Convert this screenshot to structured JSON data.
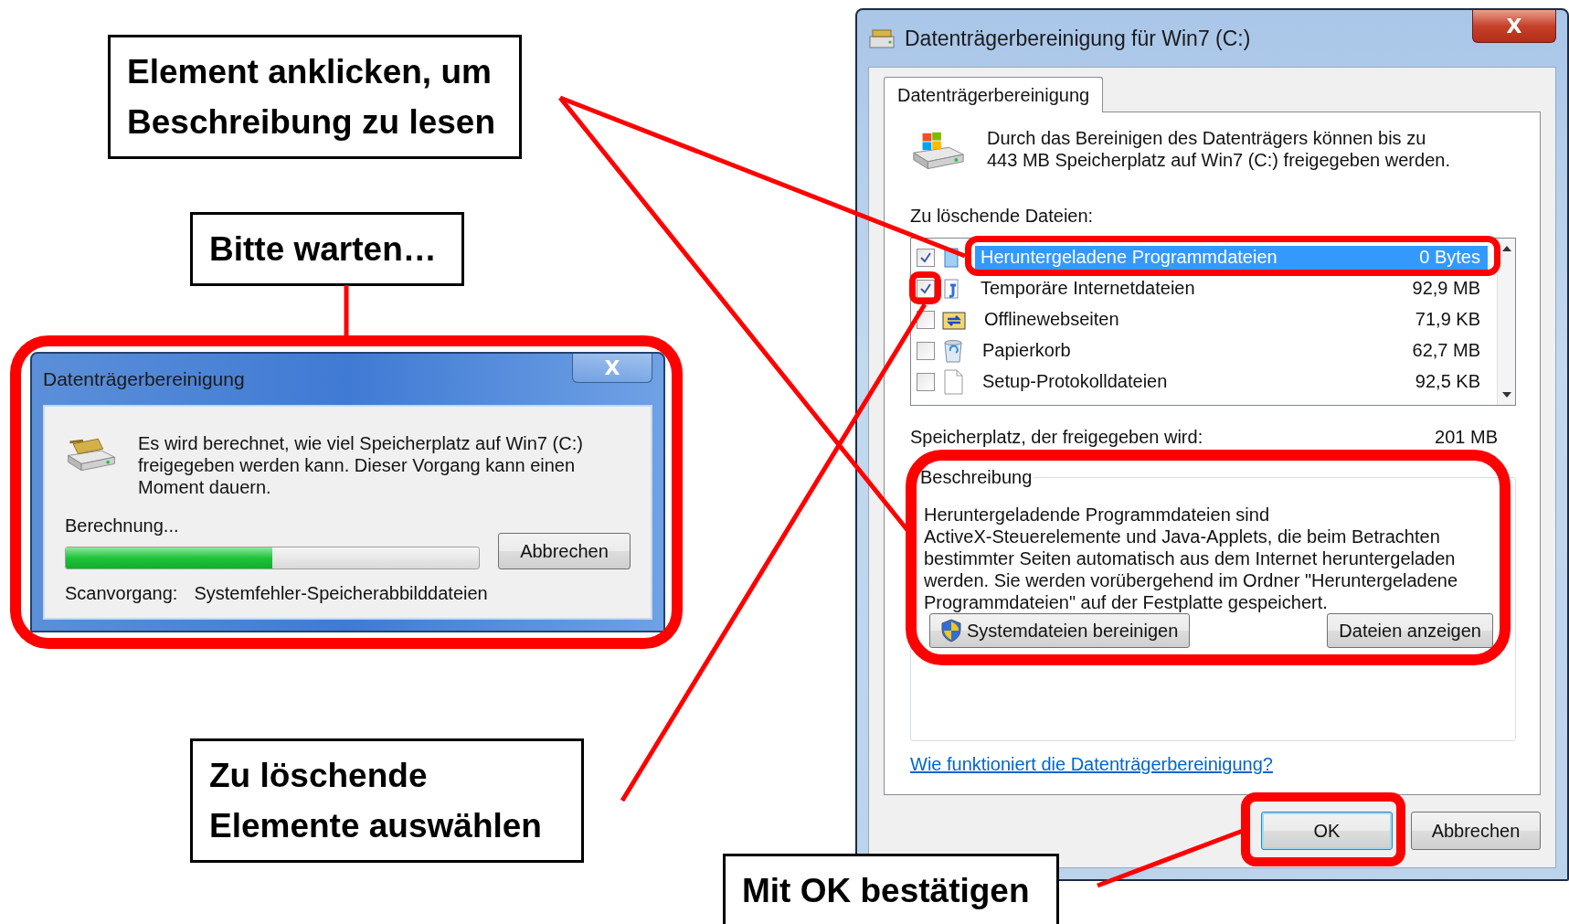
{
  "callouts": [
    {
      "lines": [
        "Element anklicken, um",
        "Beschreibung zu lesen"
      ]
    },
    {
      "lines": [
        "Bitte warten…"
      ]
    },
    {
      "lines": [
        "Zu löschende",
        "Elemente auswählen"
      ]
    },
    {
      "lines": [
        "Mit OK bestätigen"
      ]
    }
  ],
  "progress_dialog": {
    "title": "Datenträgerbereinigung",
    "close": "X",
    "message": [
      "Es wird berechnet, wie viel Speicherplatz auf Win7 (C:)",
      "freigegeben werden kann. Dieser Vorgang kann einen",
      "Moment dauern."
    ],
    "status": "Berechnung...",
    "progress": {
      "level": 0.5
    },
    "cancel_button": "Abbrechen",
    "scan_label": "Scanvorgang:",
    "scan_item": "Systemfehler-Speicherabbilddateien"
  },
  "cleanup_dialog": {
    "title": "Datenträgerbereinigung für Win7 (C:)",
    "close": "X",
    "tabs": [
      {
        "label": "Datenträgerbereinigung",
        "selected": true
      }
    ],
    "intro": [
      "Durch das Bereinigen des Datenträgers können bis zu",
      "443 MB Speicherplatz auf Win7 (C:) freigegeben werden."
    ],
    "files_label": "Zu löschende Dateien:",
    "files": [
      {
        "name": "Heruntergeladene Programmdateien",
        "size": "0 Bytes",
        "checked": true,
        "selected": true
      },
      {
        "name": "Temporäre Internetdateien",
        "size": "92,9 MB",
        "checked": true,
        "selected": false
      },
      {
        "name": "Offlinewebseiten",
        "size": "71,9 KB",
        "checked": false,
        "selected": false
      },
      {
        "name": "Papierkorb",
        "size": "62,7 MB",
        "checked": false,
        "selected": false
      },
      {
        "name": "Setup-Protokolldateien",
        "size": "92,5 KB",
        "checked": false,
        "selected": false
      }
    ],
    "freed_label": "Speicherplatz, der freigegeben wird:",
    "freed_value": "201 MB",
    "description_title": "Beschreibung",
    "description": [
      "Heruntergeladende Programmdateien sind",
      "ActiveX-Steuerelemente und Java-Applets, die beim Betrachten",
      "bestimmter Seiten automatisch aus dem Internet heruntergeladen",
      "werden. Sie werden vorübergehend im Ordner \"Heruntergeladene",
      "Programmdateien\" auf der Festplatte gespeichert."
    ],
    "system_button": "Systemdateien bereinigen",
    "view_button": "Dateien anzeigen",
    "help_link": "Wie funktioniert die Datenträgerbereinigung?",
    "ok_button": "OK",
    "cancel_button": "Abbrechen"
  }
}
